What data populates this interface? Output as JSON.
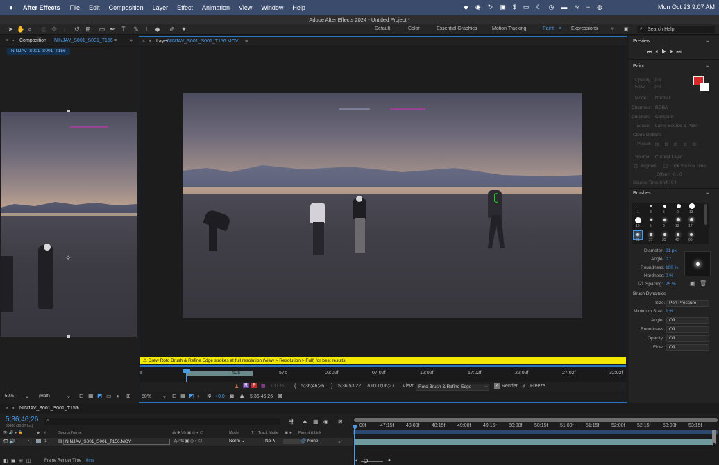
{
  "menubar": {
    "app_name": "After Effects",
    "items": [
      "File",
      "Edit",
      "Composition",
      "Layer",
      "Effect",
      "Animation",
      "View",
      "Window",
      "Help"
    ],
    "clock": "Mon Oct 23  9:07 AM"
  },
  "window_title": "Adobe After Effects 2024 - Untitled Project *",
  "workspaces": [
    "Default",
    "Color",
    "Essential Graphics",
    "Motion Tracking",
    "Paint",
    "Expressions"
  ],
  "active_workspace": "Paint",
  "search_help": "Search Help",
  "comp_panel": {
    "tab_prefix": "Composition",
    "tab_name": "NINJAV_S001_S001_T156",
    "sub_tab": "NINJAV_S001_S001_T156",
    "zoom": "50%",
    "resolution": "(Half)"
  },
  "layer_panel": {
    "tab_prefix": "Layer",
    "tab_name": "NINJAV_S001_S001_T156.MOV",
    "warning": "Draw Roto Brush & Refine Edge strokes at full resolution (View > Resolution > Full) for best results.",
    "ruler": [
      "s",
      "52s",
      "57s",
      "02:02f",
      "07:02f",
      "12:02f",
      "17:02f",
      "22:02f",
      "27:02f",
      "32:02f"
    ],
    "zoom_pct": "100 %",
    "time_in": "5;36;46;26",
    "time_out": "5;36;53;22",
    "duration": "Δ 0;00;06;27",
    "view_label": "View:",
    "view_value": "Roto Brush & Refine Edge",
    "render_label": "Render",
    "freeze_label": "Freeze",
    "bottom_zoom": "50%",
    "exposure": "+0.0",
    "current_time": "5;36;46;26"
  },
  "preview": {
    "title": "Preview"
  },
  "paint": {
    "title": "Paint",
    "opacity_label": "Opacity:",
    "opacity": "0 %",
    "flow_label": "Flow:",
    "flow": "0 %",
    "mode_label": "Mode:",
    "mode": "Normal",
    "channels_label": "Channels:",
    "channels": "RGBA",
    "duration_label": "Duration:",
    "duration": "Constant",
    "erase_label": "Erase:",
    "erase": "Layer Source & Paint",
    "clone_options": "Clone Options",
    "preset_label": "Preset:",
    "source_label": "Source:",
    "source": "Current Layer",
    "aligned": "Aligned",
    "lock_source": "Lock Source Time",
    "offset_label": "Offset:",
    "offset": "0 , 0",
    "source_time_shift": "Source Time Shift:  0 f",
    "fg_color": "#d42a2a",
    "bg_color": "#ffffff"
  },
  "brushes": {
    "title": "Brushes",
    "sizes": [
      "1",
      "3",
      "5",
      "9",
      "13",
      "19",
      "5",
      "9",
      "13",
      "17",
      "21",
      "27",
      "35",
      "45",
      "65"
    ],
    "diameter_label": "Diameter:",
    "diameter": "21 px",
    "angle_label": "Angle:",
    "angle": "0 °",
    "roundness_label": "Roundness:",
    "roundness": "100 %",
    "hardness_label": "Hardness:",
    "hardness": "0 %",
    "spacing_label": "Spacing:",
    "spacing": "25 %",
    "dynamics_title": "Brush Dynamics",
    "size_label": "Size:",
    "size": "Pen Pressure",
    "min_size_label": "Minimum Size:",
    "min_size": "1 %",
    "dyn_angle_label": "Angle:",
    "dyn_angle": "Off",
    "dyn_roundness_label": "Roundness:",
    "dyn_roundness": "Off",
    "dyn_opacity_label": "Opacity:",
    "dyn_opacity": "Off",
    "dyn_flow_label": "Flow:",
    "dyn_flow": "Off"
  },
  "timeline": {
    "tab_name": "NINJAV_S001_S001_T156",
    "timecode": "5;36;46;26",
    "fps": "60480 (29.97 fps)",
    "search_placeholder": "",
    "col_hash": "#",
    "col_source": "Source Name",
    "col_mode": "Mode",
    "col_t": "T",
    "col_trackmatte": "Track Matte",
    "col_parent": "Parent & Link",
    "layer_index": "1",
    "layer_name": "NINJAV_S001_S001_T156.MOV",
    "layer_mode": "Norm",
    "layer_matte": "No",
    "layer_parent": "None",
    "ruler": [
      "00f",
      "47:15f",
      "48:00f",
      "48:15f",
      "49:00f",
      "49:15f",
      "50:00f",
      "50:15f",
      "51:00f",
      "51:15f",
      "52:00f",
      "52:15f",
      "53:00f",
      "53:15f"
    ],
    "render_time_label": "Frame Render Time",
    "render_time": "0ms"
  }
}
